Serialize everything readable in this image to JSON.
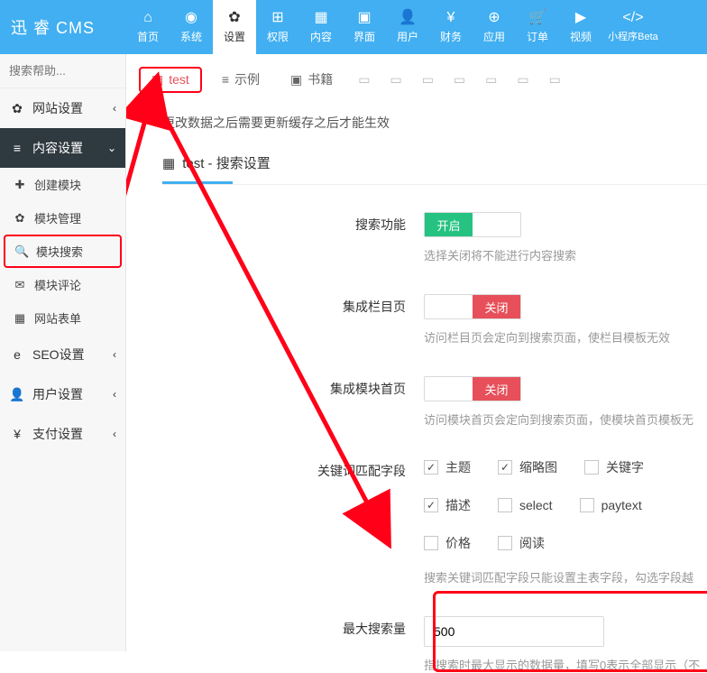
{
  "brand": "迅 睿 CMS",
  "topnav": [
    {
      "icon": "⌂",
      "label": "首页"
    },
    {
      "icon": "◉",
      "label": "系统"
    },
    {
      "icon": "✿",
      "label": "设置"
    },
    {
      "icon": "⊞",
      "label": "权限"
    },
    {
      "icon": "▦",
      "label": "内容"
    },
    {
      "icon": "▣",
      "label": "界面"
    },
    {
      "icon": "👤",
      "label": "用户"
    },
    {
      "icon": "¥",
      "label": "财务"
    },
    {
      "icon": "⊕",
      "label": "应用"
    },
    {
      "icon": "🛒",
      "label": "订单"
    },
    {
      "icon": "▶",
      "label": "视频"
    },
    {
      "icon": "</>",
      "label": "小程序Beta"
    }
  ],
  "search": {
    "placeholder": "搜索帮助..."
  },
  "menu": {
    "group1": {
      "icon": "✿",
      "label": "网站设置"
    },
    "group2": {
      "icon": "≡",
      "label": "内容设置",
      "items": [
        {
          "icon": "✚",
          "label": "创建模块"
        },
        {
          "icon": "✿",
          "label": "模块管理"
        },
        {
          "icon": "🔍",
          "label": "模块搜索"
        },
        {
          "icon": "✉",
          "label": "模块评论"
        },
        {
          "icon": "▦",
          "label": "网站表单"
        }
      ]
    },
    "group3": {
      "icon": "e",
      "label": "SEO设置"
    },
    "group4": {
      "icon": "👤",
      "label": "用户设置"
    },
    "group5": {
      "icon": "¥",
      "label": "支付设置"
    }
  },
  "tabs": {
    "active": {
      "icon": "▦",
      "label": "test"
    },
    "t2": {
      "icon": "≡",
      "label": "示例"
    },
    "t3": {
      "icon": "▣",
      "label": "书籍"
    }
  },
  "note": "更改数据之后需要更新缓存之后才能生效",
  "panel_title": "test - 搜索设置",
  "panel_icon": "▦",
  "form": {
    "search_enable": {
      "label": "搜索功能",
      "on": "开启",
      "hint": "选择关闭将不能进行内容搜索"
    },
    "col_index": {
      "label": "集成栏目页",
      "off": "关闭",
      "hint": "访问栏目页会定向到搜索页面，使栏目模板无效"
    },
    "mod_index": {
      "label": "集成模块首页",
      "off": "关闭",
      "hint": "访问模块首页会定向到搜索页面，使模块首页模板无"
    },
    "fields": {
      "label": "关键词匹配字段",
      "opts": [
        {
          "label": "主题",
          "checked": true
        },
        {
          "label": "缩略图",
          "checked": true
        },
        {
          "label": "关键字",
          "checked": false
        },
        {
          "label": "描述",
          "checked": true
        },
        {
          "label": "select",
          "checked": false
        },
        {
          "label": "paytext",
          "checked": false
        },
        {
          "label": "价格",
          "checked": false
        },
        {
          "label": "阅读",
          "checked": false
        }
      ],
      "hint": "搜索关键词匹配字段只能设置主表字段，勾选字段越"
    },
    "max": {
      "label": "最大搜索量",
      "value": "500",
      "hint": "指搜索时最大显示的数据量，填写0表示全部显示（不"
    }
  }
}
